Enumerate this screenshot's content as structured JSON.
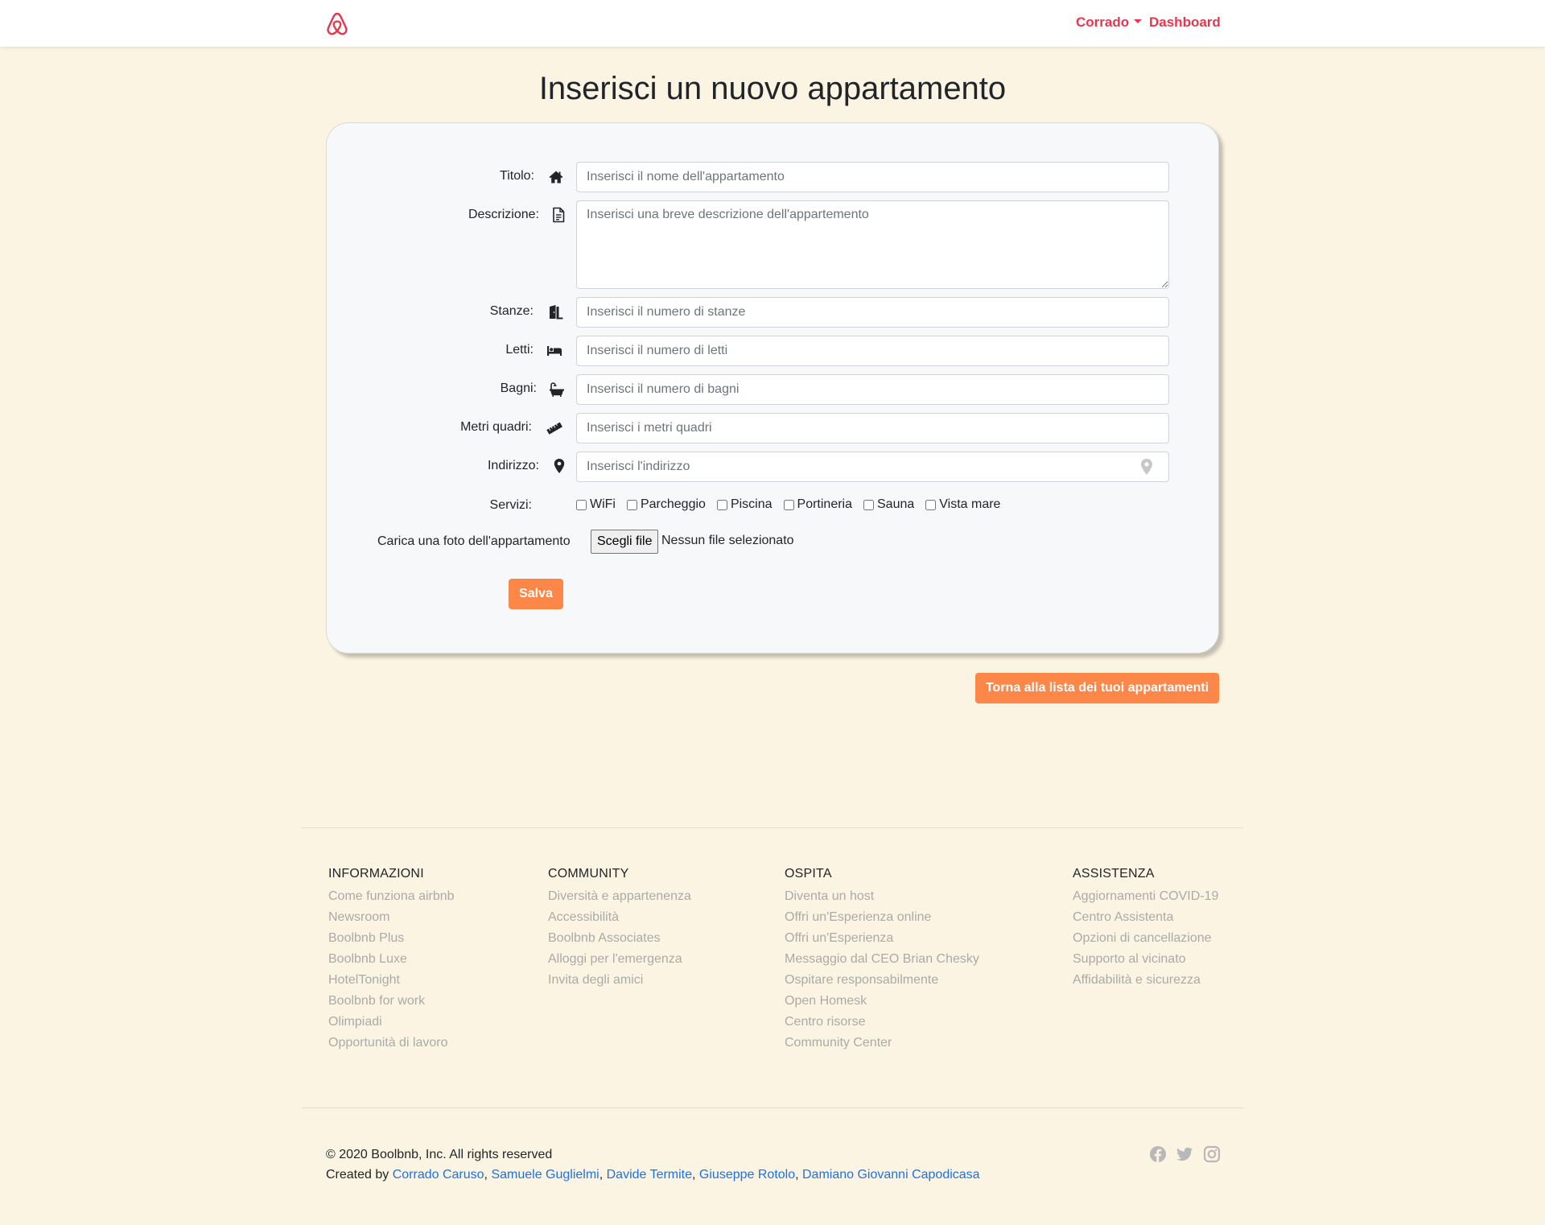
{
  "navbar": {
    "logo_icon": "airbnb-logo",
    "user_name": "Corrado",
    "dashboard_label": "Dashboard",
    "accent_color": "#e8364d"
  },
  "page": {
    "title": "Inserisci un nuovo appartamento",
    "background_color": "#fcf4e2"
  },
  "form": {
    "fields": [
      {
        "label": "Titolo:",
        "icon": "home-icon",
        "placeholder": "Inserisci il nome dell'appartamento"
      },
      {
        "label": "Descrizione:",
        "icon": "document-icon",
        "placeholder": "Inserisci una breve descrizione dell'appartemento"
      },
      {
        "label": "Stanze:",
        "icon": "door-icon",
        "placeholder": "Inserisci il numero di stanze"
      },
      {
        "label": "Letti:",
        "icon": "bed-icon",
        "placeholder": "Inserisci il numero di letti"
      },
      {
        "label": "Bagni:",
        "icon": "bath-icon",
        "placeholder": "Inserisci il numero di bagni"
      },
      {
        "label": "Metri quadri:",
        "icon": "ruler-icon",
        "placeholder": "Inserisci i metri quadri"
      },
      {
        "label": "Indirizzo:",
        "icon": "map-marker-icon",
        "placeholder": "Inserisci l'indirizzo"
      }
    ],
    "services_label": "Servizi:",
    "services": [
      "WiFi",
      "Parcheggio",
      "Piscina",
      "Portineria",
      "Sauna",
      "Vista mare"
    ],
    "photo_label": "Carica una foto dell'appartamento",
    "file_button": "Scegli file",
    "file_status": "Nessun file selezionato",
    "save_button": "Salva",
    "button_color": "#fd8649"
  },
  "back_button": "Torna alla lista dei tuoi appartamenti",
  "footer": {
    "columns": [
      {
        "heading": "INFORMAZIONI",
        "links": [
          "Come funziona airbnb",
          "Newsroom",
          "Boolbnb Plus",
          "Boolbnb Luxe",
          "HotelTonight",
          "Boolbnb for work",
          "Olimpiadi",
          "Opportunità di lavoro"
        ]
      },
      {
        "heading": "COMMUNITY",
        "links": [
          "Diversità e appartenenza",
          "Accessibilità",
          "Boolbnb Associates",
          "Alloggi per l'emergenza",
          "Invita degli amici"
        ]
      },
      {
        "heading": "OSPITA",
        "links": [
          "Diventa un host",
          "Offri un'Esperienza online",
          "Offri un'Esperienza",
          "Messaggio dal CEO Brian Chesky",
          "Ospitare responsabilmente",
          "Open Homesk",
          "Centro risorse",
          "Community Center"
        ]
      },
      {
        "heading": "ASSISTENZA",
        "links": [
          "Aggiornamenti COVID-19",
          "Centro Assistenta",
          "Opzioni di cancellazione",
          "Supporto al vicinato",
          "Affidabilità e sicurezza"
        ]
      }
    ],
    "copyright": "© 2020 Boolbnb, Inc. All rights reserved",
    "created_by": "Created by",
    "authors": [
      "Corrado Caruso",
      "Samuele Guglielmi",
      "Davide Termite",
      "Giuseppe Rotolo",
      "Damiano Giovanni Capodicasa"
    ],
    "social_icons": [
      "facebook-icon",
      "twitter-icon",
      "instagram-icon"
    ]
  }
}
